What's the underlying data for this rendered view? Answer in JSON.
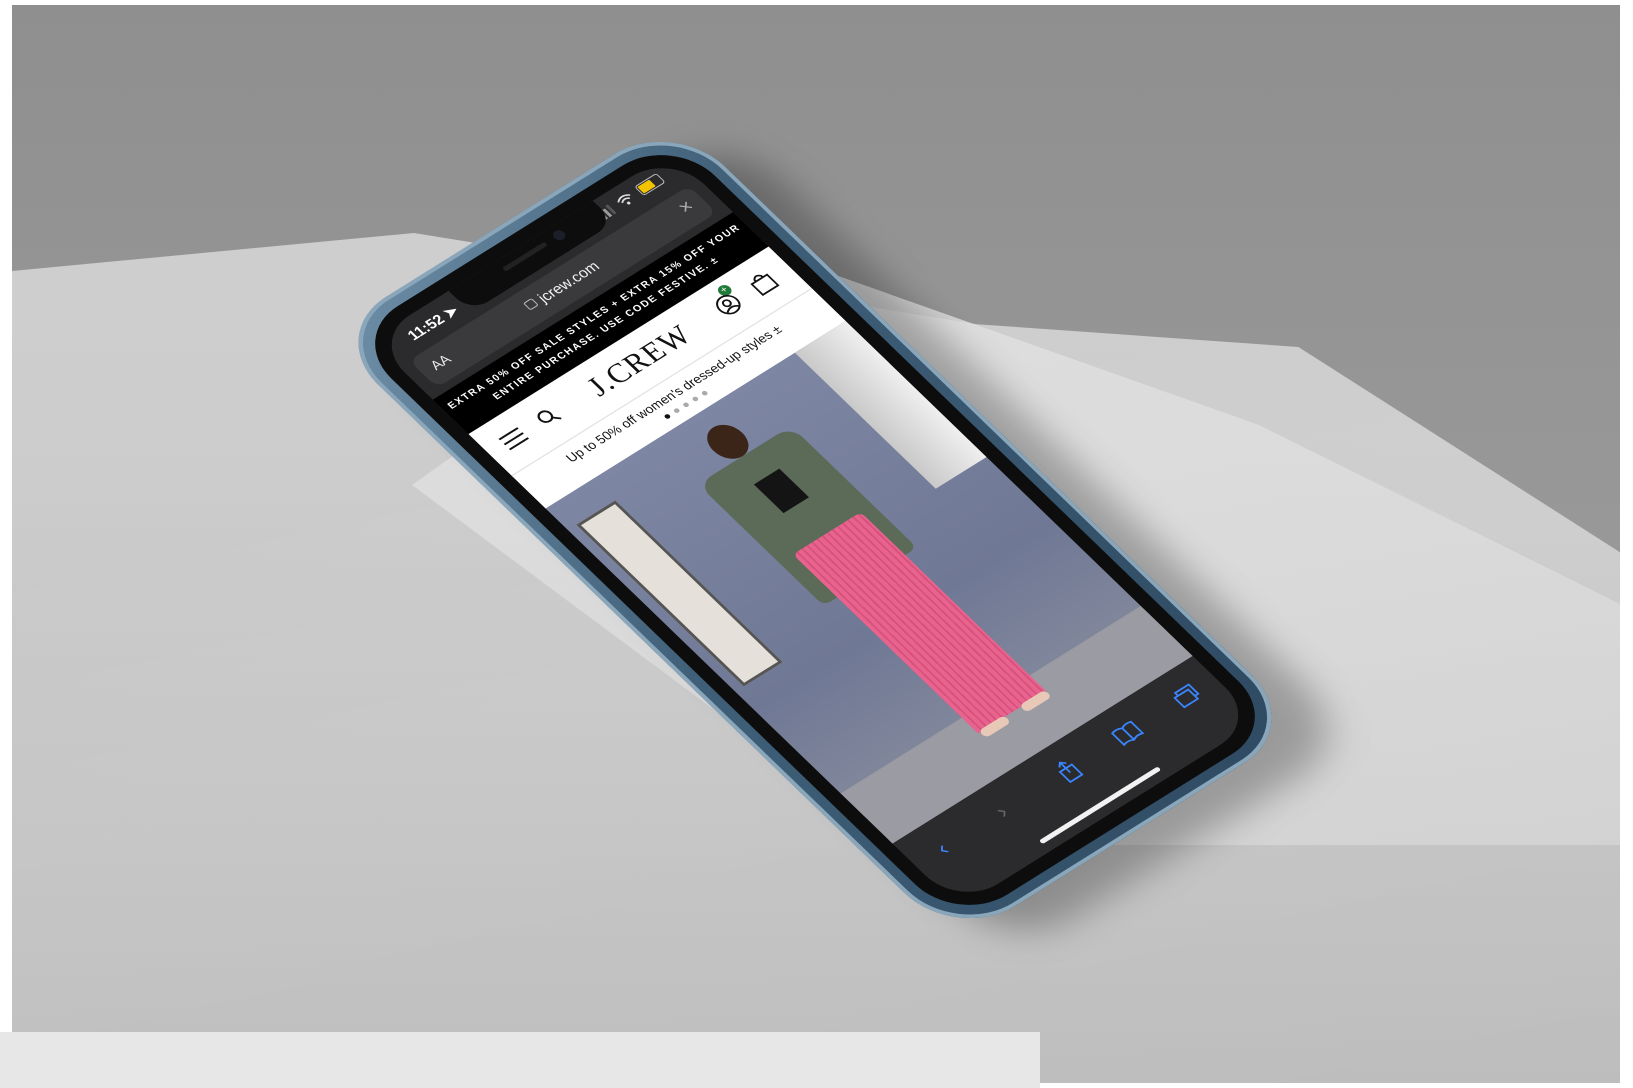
{
  "status_bar": {
    "time": "11:52"
  },
  "browser": {
    "text_size_label": "AA",
    "url": "jcrew.com",
    "close_label": "×"
  },
  "site": {
    "promo_line_1": "EXTRA 50% OFF SALE STYLES + EXTRA 15% OFF YOUR",
    "promo_line_2": "ENTIRE PURCHASE. USE CODE FESTIVE. ±",
    "logo": "J.CREW",
    "account_badge": "+",
    "sub_promo": "Up to 50% off women's dressed-up styles ±",
    "carousel": {
      "count": 5,
      "active_index": 0
    }
  },
  "toolbar": {
    "back_icon": "‹",
    "forward_icon": "›"
  },
  "colors": {
    "phone_frame": "#3f5f78",
    "browser_chrome": "#2b2b2d",
    "toolbar_accent": "#3a86ff",
    "account_badge": "#1f7a3a",
    "battery": "#f4c300"
  },
  "icons": [
    "location-arrow-icon",
    "signal-icon",
    "wifi-icon",
    "battery-icon",
    "lock-icon",
    "close-icon",
    "menu-icon",
    "search-icon",
    "account-icon",
    "bag-icon",
    "back-icon",
    "forward-icon",
    "share-icon",
    "bookmarks-icon",
    "tabs-icon"
  ]
}
